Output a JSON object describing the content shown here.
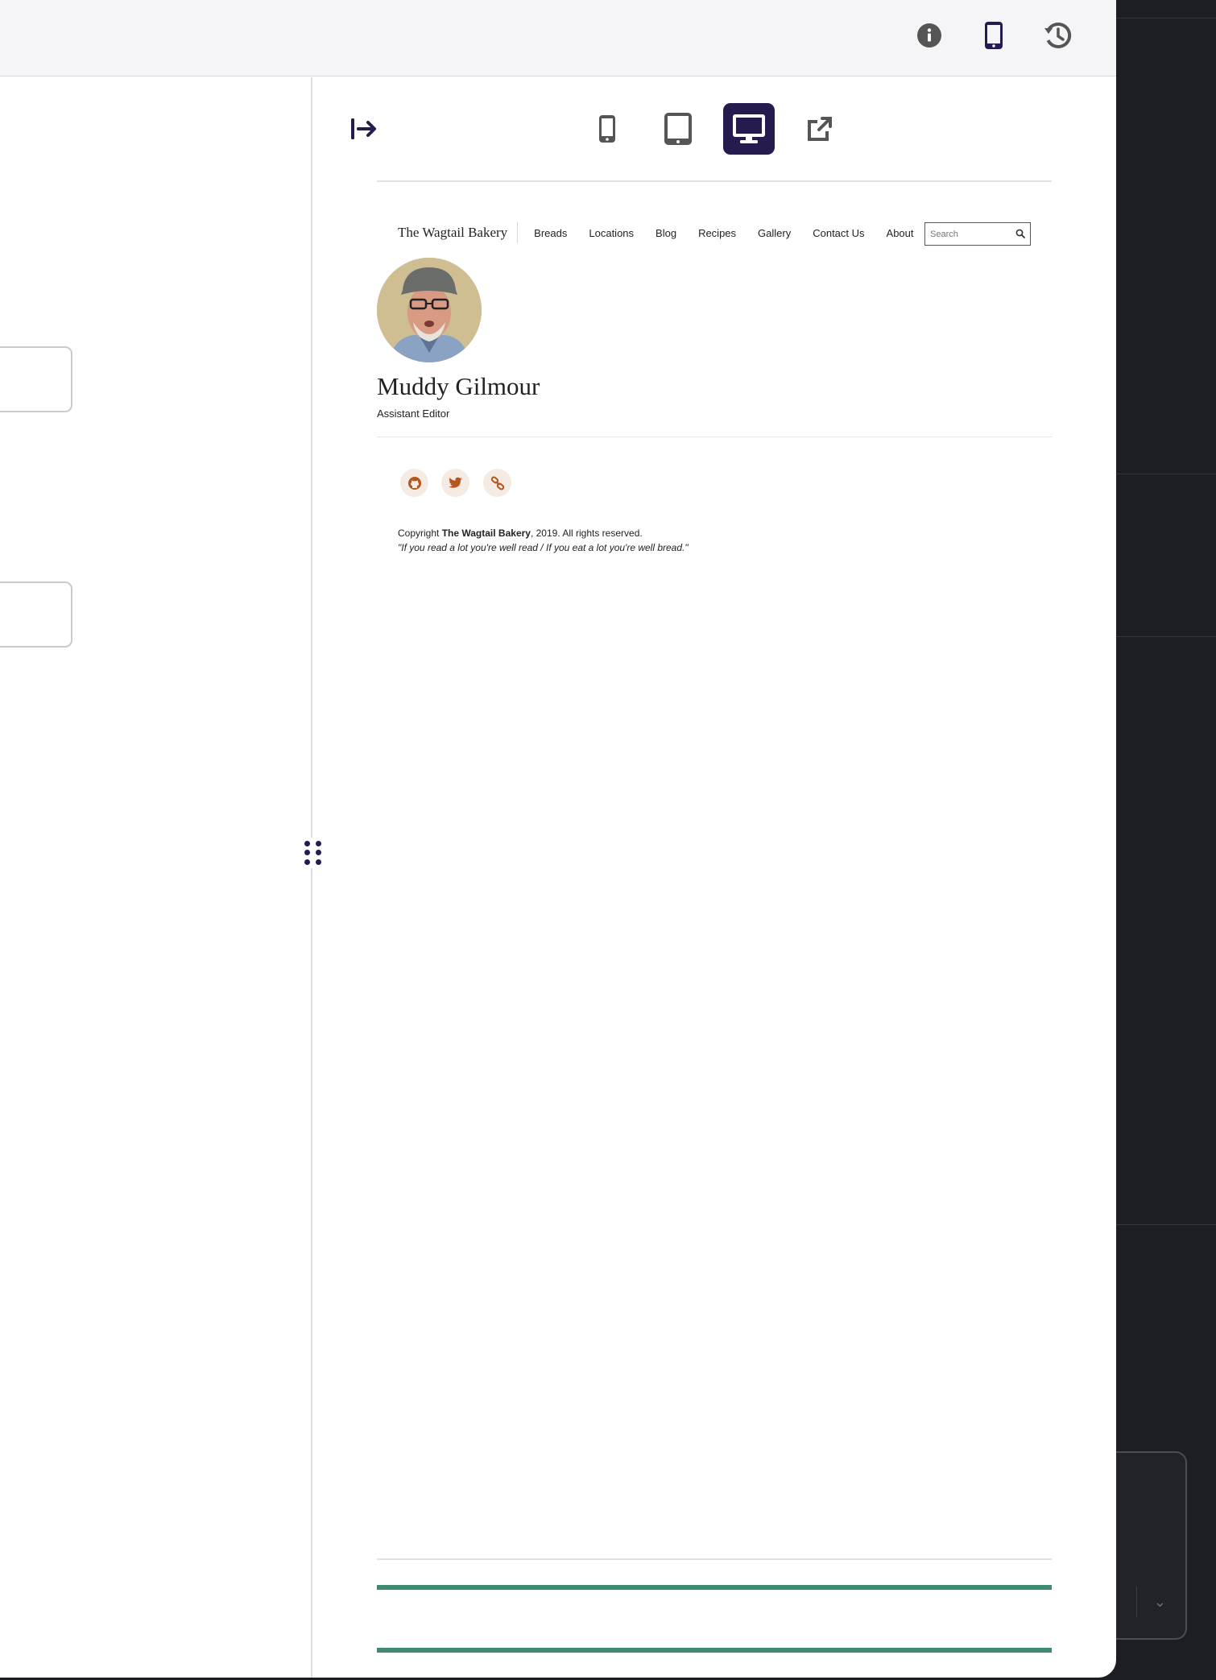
{
  "toolbar": {
    "icons": [
      "info-icon",
      "mobile-preview-icon",
      "history-icon"
    ]
  },
  "preview": {
    "devices": [
      "mobile",
      "tablet",
      "desktop"
    ],
    "active_device": "desktop"
  },
  "site": {
    "brand": "The Wagtail Bakery",
    "nav": [
      "Breads",
      "Locations",
      "Blog",
      "Recipes",
      "Gallery",
      "Contact Us",
      "About"
    ],
    "search_placeholder": "Search"
  },
  "person": {
    "name": "Muddy Gilmour",
    "role": "Assistant Editor"
  },
  "footer": {
    "copyright_prefix": "Copyright ",
    "copyright_brand": "The Wagtail Bakery",
    "copyright_suffix": ", 2019. All rights reserved.",
    "motto": "\"If you read a lot you're well read / If you eat a lot you're well bread.\""
  },
  "colors": {
    "accent": "#261a4f",
    "social": "#b5561e",
    "green": "#3e8a72"
  }
}
